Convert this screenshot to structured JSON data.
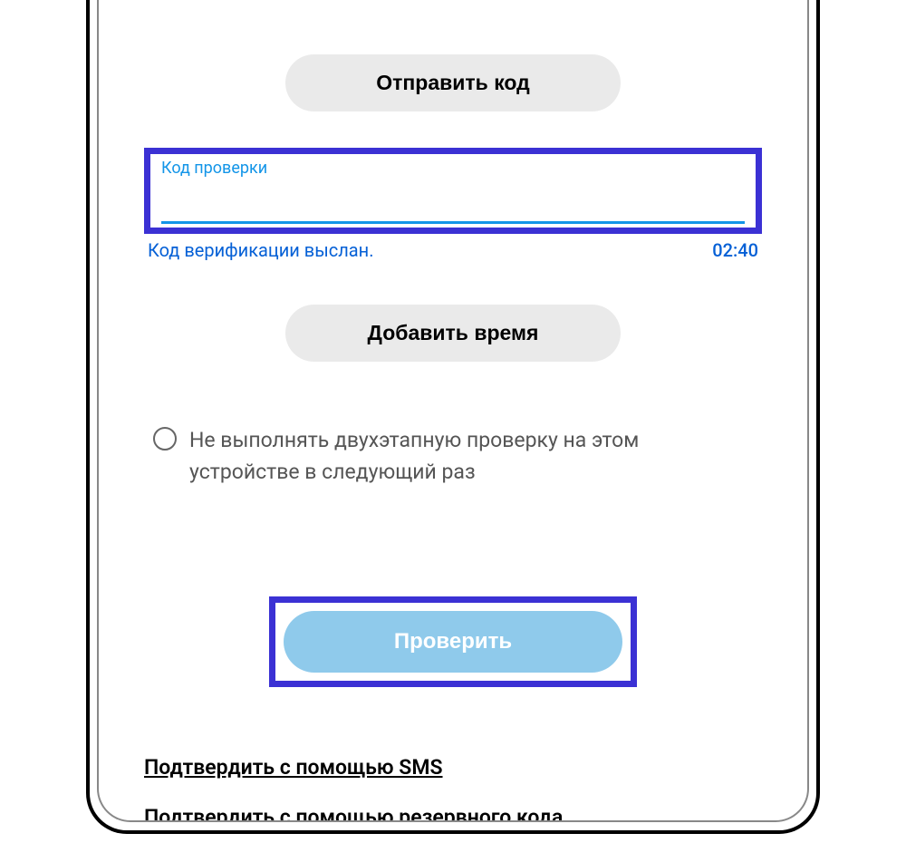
{
  "buttons": {
    "send_code": "Отправить код",
    "add_time": "Добавить время",
    "verify": "Проверить"
  },
  "input": {
    "label": "Код проверки",
    "value": ""
  },
  "status": {
    "message": "Код верификации выслан.",
    "timer": "02:40"
  },
  "checkbox": {
    "label": "Не выполнять двухэтапную проверку на этом устройстве в следующий раз"
  },
  "links": {
    "confirm_sms": "Подтвердить с помощью SMS",
    "confirm_backup": "Подтвердить с помощью резервного кода"
  }
}
